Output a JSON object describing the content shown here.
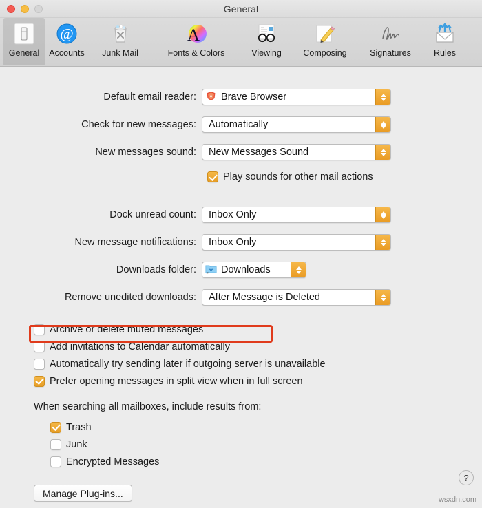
{
  "window": {
    "title": "General",
    "traffic_lights": [
      "close-button",
      "minimize-button",
      "zoom-button"
    ]
  },
  "toolbar": {
    "items": [
      {
        "label": "General",
        "icon": "switch-icon",
        "selected": true
      },
      {
        "label": "Accounts",
        "icon": "at-sign-icon",
        "selected": false
      },
      {
        "label": "Junk Mail",
        "icon": "trash-x-icon",
        "selected": false
      },
      {
        "label": "Fonts & Colors",
        "icon": "font-color-icon",
        "selected": false
      },
      {
        "label": "Viewing",
        "icon": "glasses-icon",
        "selected": false
      },
      {
        "label": "Composing",
        "icon": "pencil-paper-icon",
        "selected": false
      },
      {
        "label": "Signatures",
        "icon": "signature-icon",
        "selected": false
      },
      {
        "label": "Rules",
        "icon": "envelope-arrows-icon",
        "selected": false
      }
    ]
  },
  "form": {
    "default_email_reader": {
      "label": "Default email reader:",
      "value": "Brave Browser",
      "icon": "brave-lion-icon"
    },
    "check_new_messages": {
      "label": "Check for new messages:",
      "value": "Automatically"
    },
    "new_messages_sound": {
      "label": "New messages sound:",
      "value": "New Messages Sound"
    },
    "play_sounds": {
      "label": "Play sounds for other mail actions",
      "checked": true
    },
    "dock_unread_count": {
      "label": "Dock unread count:",
      "value": "Inbox Only"
    },
    "new_message_notifications": {
      "label": "New message notifications:",
      "value": "Inbox Only"
    },
    "downloads_folder": {
      "label": "Downloads folder:",
      "value": "Downloads",
      "icon": "downloads-folder-icon"
    },
    "remove_unedited_downloads": {
      "label": "Remove unedited downloads:",
      "value": "After Message is Deleted"
    }
  },
  "checkboxes": [
    {
      "label": "Archive or delete muted messages",
      "checked": false
    },
    {
      "label": "Add invitations to Calendar automatically",
      "checked": false,
      "highlighted": true
    },
    {
      "label": "Automatically try sending later if outgoing server is unavailable",
      "checked": false
    },
    {
      "label": "Prefer opening messages in split view when in full screen",
      "checked": true
    }
  ],
  "search_section": {
    "note": "When searching all mailboxes, include results from:",
    "options": [
      {
        "label": "Trash",
        "checked": true
      },
      {
        "label": "Junk",
        "checked": false
      },
      {
        "label": "Encrypted Messages",
        "checked": false
      }
    ]
  },
  "footer": {
    "manage_plugins_label": "Manage Plug-ins...",
    "help_label": "?",
    "watermark": "wsxdn.com"
  },
  "colors": {
    "accent": "#e79d26",
    "annotation": "#e03b1c",
    "background": "#ececec"
  }
}
